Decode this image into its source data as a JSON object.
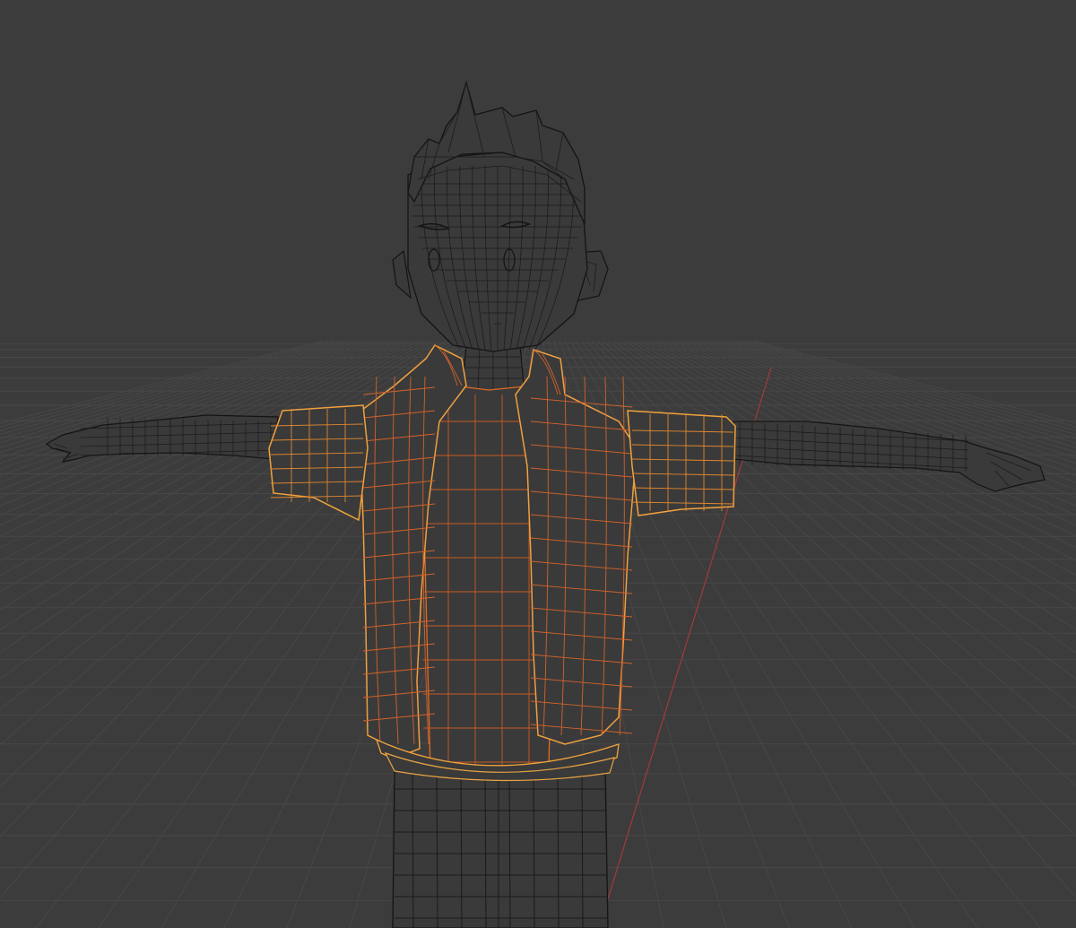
{
  "viewport": {
    "background": "#3c3c3c",
    "grid_color": "#464646",
    "horizon_grid_color": "#4a4a4a",
    "axis_y_color": "#b33a3a",
    "wire_unselected": "#141414",
    "wire_selected": "#e8762a",
    "wire_selected_outline": "#f2a23c",
    "body_fill": "#3a3a3a",
    "view_mode": "wireframe",
    "selected_object": "vest-and-shirt",
    "character_pose": "t-pose"
  }
}
